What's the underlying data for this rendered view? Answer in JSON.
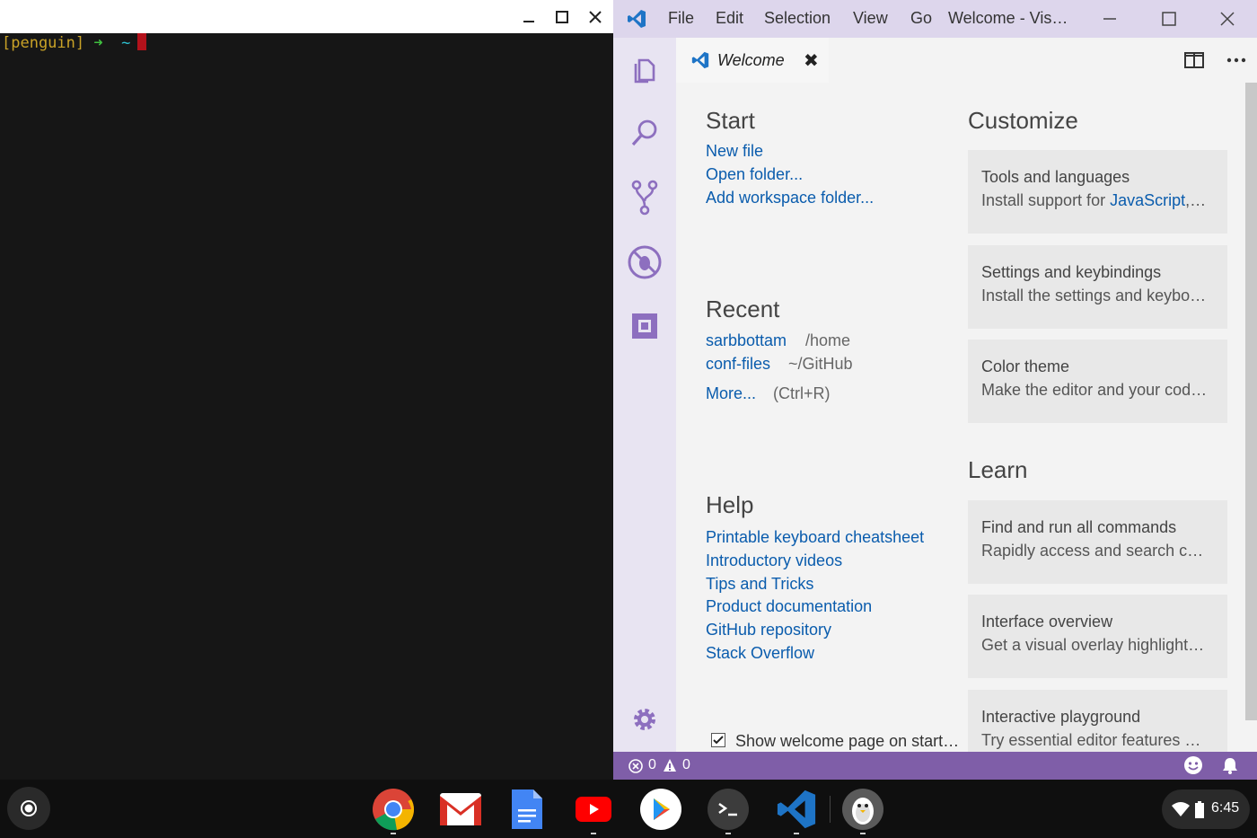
{
  "terminal": {
    "prompt_user": "[penguin]",
    "prompt_arrow": "➜",
    "prompt_dir": "~",
    "minimize_icon": "minimize-icon",
    "maximize_icon": "maximize-icon",
    "close_icon": "close-icon"
  },
  "vscode": {
    "menu": [
      "File",
      "Edit",
      "Selection",
      "View",
      "Go"
    ],
    "window_title": "Welcome - Vis…",
    "activity_icons": [
      "explorer-icon",
      "search-icon",
      "source-control-icon",
      "debug-icon",
      "extensions-icon",
      "gear-icon"
    ],
    "tab": {
      "label": "Welcome",
      "close": "✖"
    },
    "start": {
      "title": "Start",
      "links": [
        "New file",
        "Open folder...",
        "Add workspace folder..."
      ]
    },
    "recent": {
      "title": "Recent",
      "items": [
        {
          "name": "sarbbottam",
          "path": "/home"
        },
        {
          "name": "conf-files",
          "path": "~/GitHub"
        }
      ],
      "more": "More...",
      "more_hint": "(Ctrl+R)"
    },
    "help": {
      "title": "Help",
      "links": [
        "Printable keyboard cheatsheet",
        "Introductory videos",
        "Tips and Tricks",
        "Product documentation",
        "GitHub repository",
        "Stack Overflow"
      ]
    },
    "show_welcome": {
      "label": "Show welcome page on start…",
      "checked": true
    },
    "customize": {
      "title": "Customize",
      "cards": [
        {
          "title": "Tools and languages",
          "desc_prefix": "Install support for ",
          "desc_link": "JavaScript",
          "desc_rest": ",…"
        },
        {
          "title": "Settings and keybindings",
          "desc_prefix": "Install the settings and keybo…",
          "desc_link": "",
          "desc_rest": ""
        },
        {
          "title": "Color theme",
          "desc_prefix": "Make the editor and your cod…",
          "desc_link": "",
          "desc_rest": ""
        }
      ]
    },
    "learn": {
      "title": "Learn",
      "cards": [
        {
          "title": "Find and run all commands",
          "desc": "Rapidly access and search c…"
        },
        {
          "title": "Interface overview",
          "desc": "Get a visual overlay highlight…"
        },
        {
          "title": "Interactive playground",
          "desc": "Try essential editor features …"
        }
      ]
    },
    "status": {
      "errors": "0",
      "warnings": "0"
    },
    "colors": {
      "accent": "#7f5ea8",
      "link": "#0a5cad",
      "titlebar": "#ddd6ec"
    }
  },
  "shelf": {
    "apps": [
      "launcher-icon",
      "chrome-icon",
      "gmail-icon",
      "docs-icon",
      "youtube-icon",
      "play-store-icon",
      "terminal-icon",
      "vscode-icon",
      "linux-icon"
    ],
    "time": "6:45"
  }
}
